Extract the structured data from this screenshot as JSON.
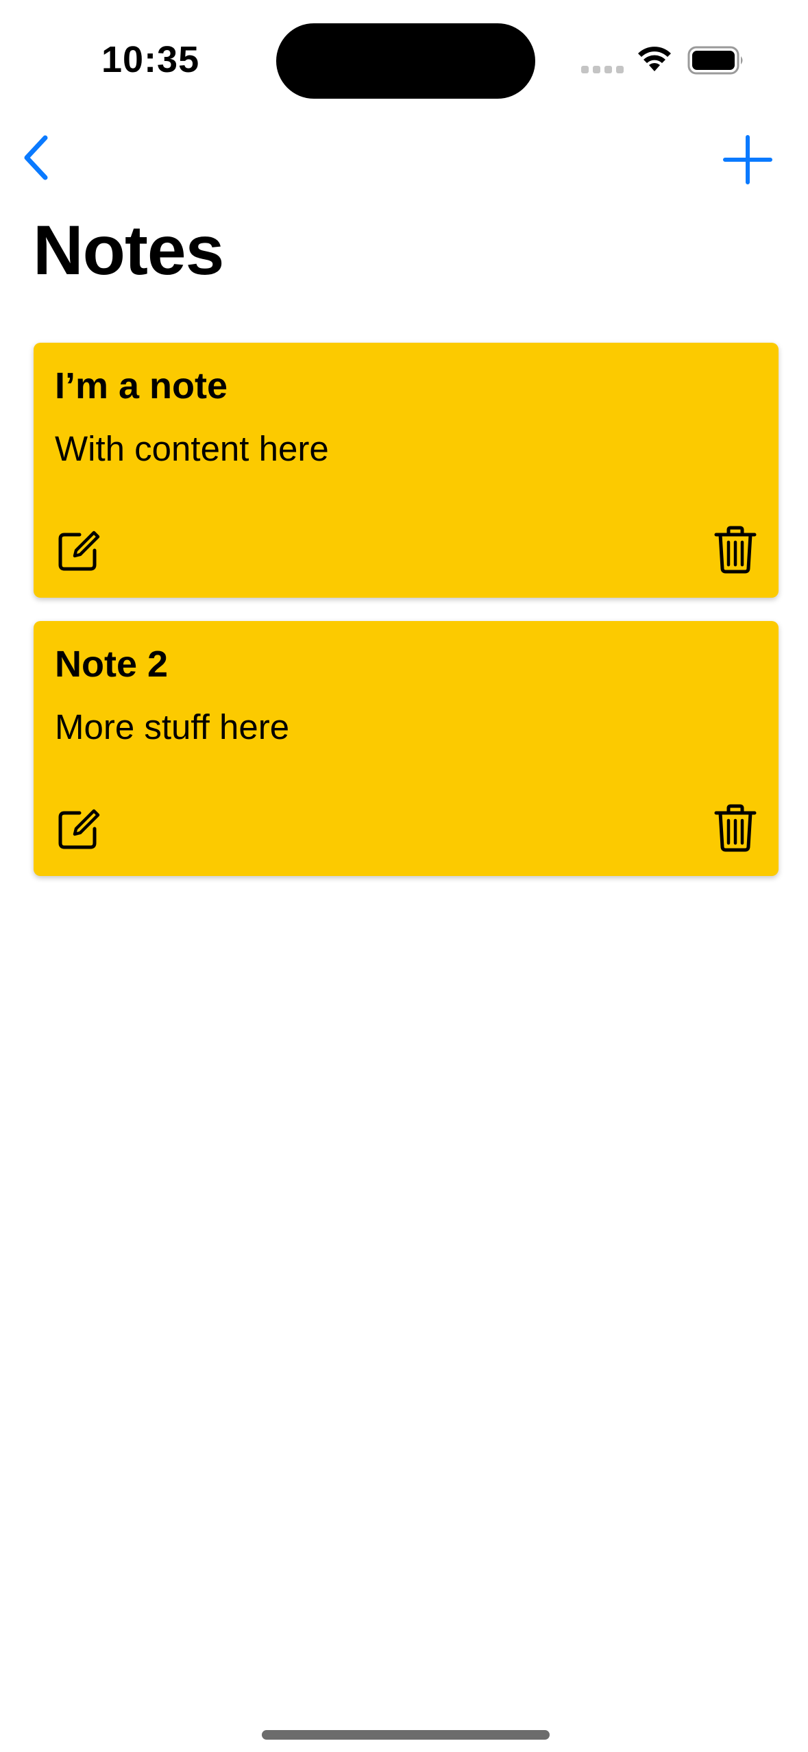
{
  "status_bar": {
    "time": "10:35"
  },
  "nav": {
    "back_icon": "chevron-left-icon",
    "add_icon": "plus-icon",
    "accent_color": "#0A7AFF"
  },
  "page": {
    "title": "Notes"
  },
  "notes": [
    {
      "title": "I’m a note",
      "content": "With content here",
      "edit_icon": "square-pencil-icon",
      "delete_icon": "trash-icon"
    },
    {
      "title": "Note 2",
      "content": "More stuff here",
      "edit_icon": "square-pencil-icon",
      "delete_icon": "trash-icon"
    }
  ],
  "colors": {
    "note_background": "#FCCA00",
    "page_background": "#FFFFFF"
  }
}
